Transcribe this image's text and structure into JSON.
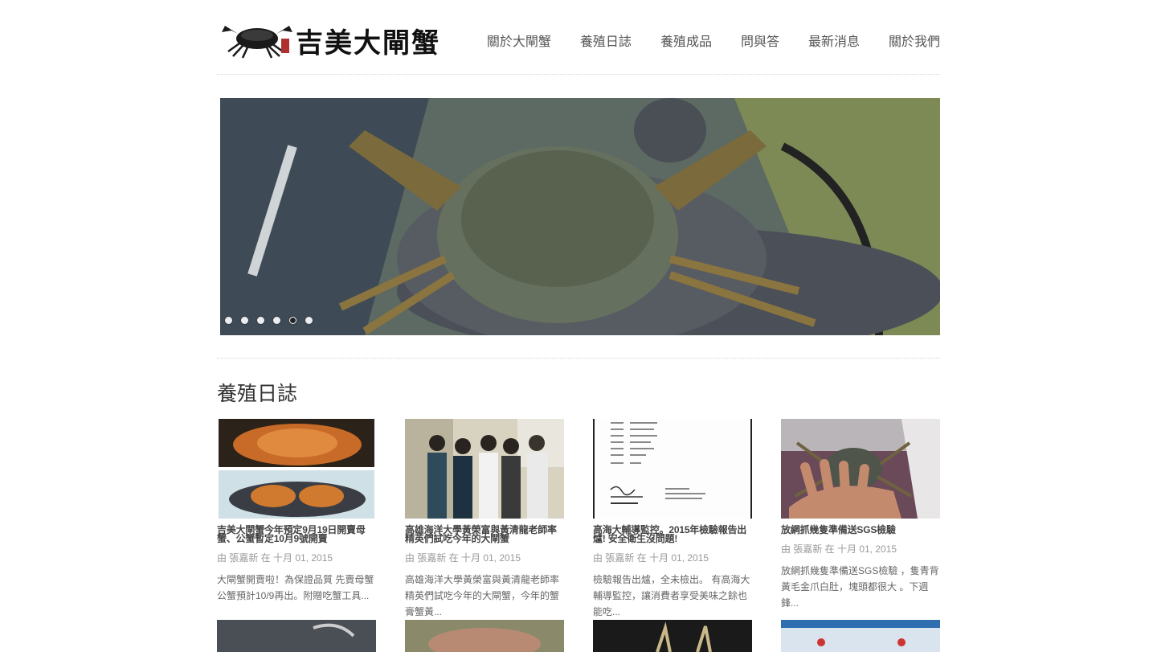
{
  "site": {
    "logo_text": "吉美大閘蟹"
  },
  "nav": [
    {
      "label": "關於大閘蟹"
    },
    {
      "label": "養殖日誌"
    },
    {
      "label": "養殖成品"
    },
    {
      "label": "問與答"
    },
    {
      "label": "最新消息"
    },
    {
      "label": "關於我們"
    }
  ],
  "slider": {
    "dot_count": 6,
    "active_index": 4
  },
  "section": {
    "title": "養殖日誌"
  },
  "posts": [
    {
      "title": "吉美大閘蟹今年預定9月19日開賣母蟹、公蟹暫定10月9號開賣",
      "meta": "由 張嘉新 在 十月 01, 2015",
      "excerpt": "大閘蟹開賣啦！為保證品質 先賣母蟹公蟹預計10/9再出。附贈吃蟹工具..."
    },
    {
      "title": "高雄海洋大學黃榮富與黃清龍老師率精英們試吃今年的大閘蟹",
      "meta": "由 張嘉新 在 十月 01, 2015",
      "excerpt": "高雄海洋大學黃榮富與黃清龍老師率精英們試吃今年的大閘蟹，今年的蟹膏蟹黃..."
    },
    {
      "title": "高海大輔導監控。2015年檢驗報告出爐! 安全衛生沒問題!",
      "meta": "由 張嘉新 在 十月 01, 2015",
      "excerpt": "檢驗報告出爐，全未檢出。 有高海大輔導監控，讓消費者享受美味之餘也能吃..."
    },
    {
      "title": "放網抓幾隻準備送SGS檢驗",
      "meta": "由 張嘉新 在 十月 01, 2015",
      "excerpt": "放網抓幾隻準備送SGS檢驗 ，隻青背黃毛金爪白肚，塊頭都很大 。下週鋒..."
    }
  ],
  "colors": {
    "text": "#333333",
    "meta": "#999999",
    "background": "#ffffff"
  }
}
